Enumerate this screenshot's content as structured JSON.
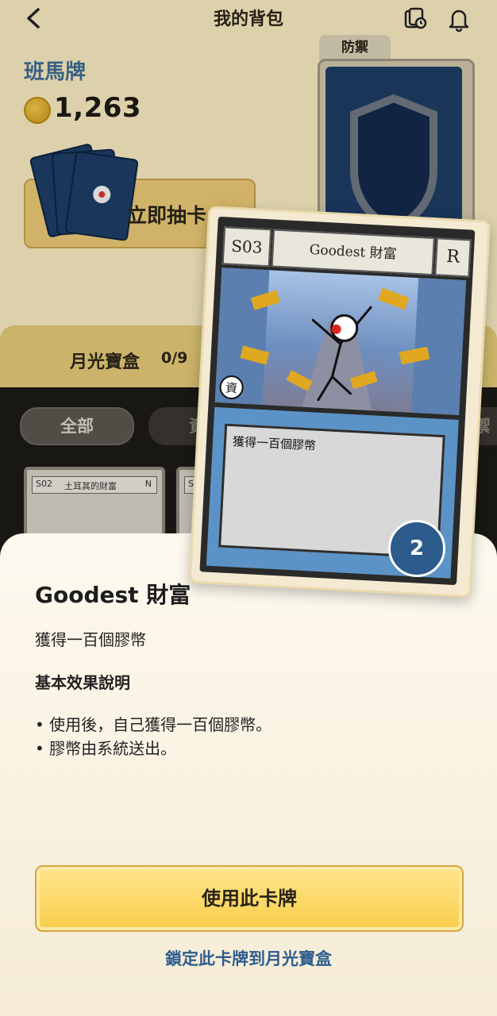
{
  "header": {
    "title": "我的背包"
  },
  "profile": {
    "brand": "班馬牌",
    "coins": "1,263"
  },
  "draw": {
    "label": "立即抽卡"
  },
  "deck": {
    "tab": "防禦"
  },
  "moonbox": {
    "label": "月光寶盒",
    "count": "0/9"
  },
  "filters": {
    "all": "全部",
    "resource": "資源",
    "defense_partial": "禦"
  },
  "thumbs": [
    {
      "code": "S02",
      "name": "土耳其的財富",
      "rarity": "N"
    },
    {
      "code": "S03"
    }
  ],
  "card": {
    "code": "S03",
    "name": "Goodest 財富",
    "rarity": "R",
    "category": "資",
    "desc": "獲得一百個膠幣",
    "count": "2"
  },
  "sheet": {
    "title": "Goodest 財富",
    "subtitle": "獲得一百個膠幣",
    "effect_heading": "基本效果說明",
    "bullets": [
      "使用後，自己獲得一百個膠幣。",
      "膠幣由系統送出。"
    ],
    "use_button": "使用此卡牌",
    "lock_link": "鎖定此卡牌到月光寶盒"
  },
  "colors": {
    "accent": "#f8cd4a",
    "link": "#2f5d8e",
    "badge": "#2c5b8c"
  }
}
